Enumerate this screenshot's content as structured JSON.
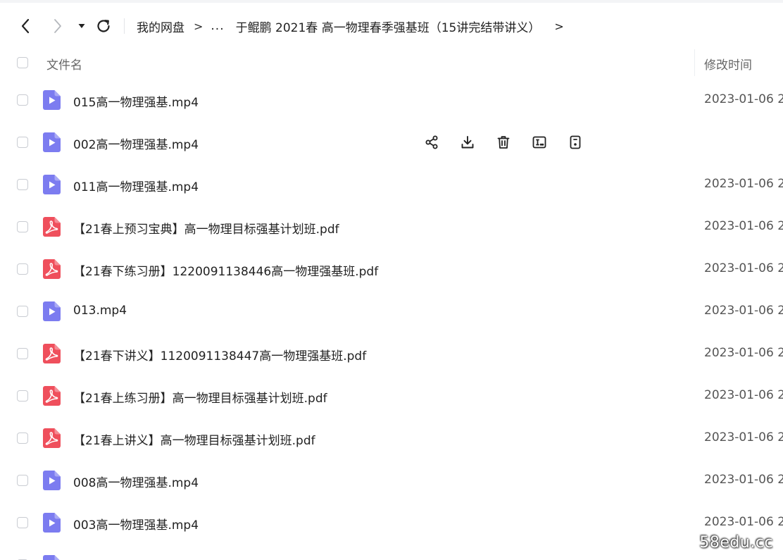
{
  "navigation": {
    "back_icon": "chevron-left-icon",
    "forward_icon": "chevron-right-icon",
    "history_icon": "caret-down-icon",
    "refresh_icon": "refresh-icon"
  },
  "breadcrumb": {
    "root": "我的网盘",
    "separator": ">",
    "ellipsis": "...",
    "current": "于鲲鹏 2021春 高一物理春季强基班（15讲完结带讲义）",
    "next_chevron": ">"
  },
  "header": {
    "name_column": "文件名",
    "time_column": "修改时间"
  },
  "row_actions": [
    "share-icon",
    "download-icon",
    "delete-icon",
    "rename-icon",
    "more-icon"
  ],
  "files": [
    {
      "name": "015高一物理强基.mp4",
      "type": "video",
      "time": "2023-01-06 2"
    },
    {
      "name": "002高一物理强基.mp4",
      "type": "video",
      "time": "",
      "hovered": true
    },
    {
      "name": "011高一物理强基.mp4",
      "type": "video",
      "time": "2023-01-06 2"
    },
    {
      "name": "【21春上预习宝典】高一物理目标强基计划班.pdf",
      "type": "pdf",
      "time": "2023-01-06 2"
    },
    {
      "name": "【21春下练习册】1220091138446高一物理强基班.pdf",
      "type": "pdf",
      "time": "2023-01-06 2"
    },
    {
      "name": "013.mp4",
      "type": "video",
      "time": "2023-01-06 2"
    },
    {
      "name": "【21春下讲义】1120091138447高一物理强基班.pdf",
      "type": "pdf",
      "time": "2023-01-06 2"
    },
    {
      "name": "【21春上练习册】高一物理目标强基计划班.pdf",
      "type": "pdf",
      "time": "2023-01-06 2"
    },
    {
      "name": "【21春上讲义】高一物理目标强基计划班.pdf",
      "type": "pdf",
      "time": "2023-01-06 2"
    },
    {
      "name": "008高一物理强基.mp4",
      "type": "video",
      "time": "2023-01-06 2"
    },
    {
      "name": "003高一物理强基.mp4",
      "type": "video",
      "time": "2023-01-06 2"
    },
    {
      "name": "",
      "type": "video",
      "time": ""
    }
  ],
  "colors": {
    "video_icon": "#7c7cf0",
    "pdf_icon": "#ef4f5c",
    "checkbox_border": "#c9ccd2"
  },
  "watermark": "58edu.cc"
}
